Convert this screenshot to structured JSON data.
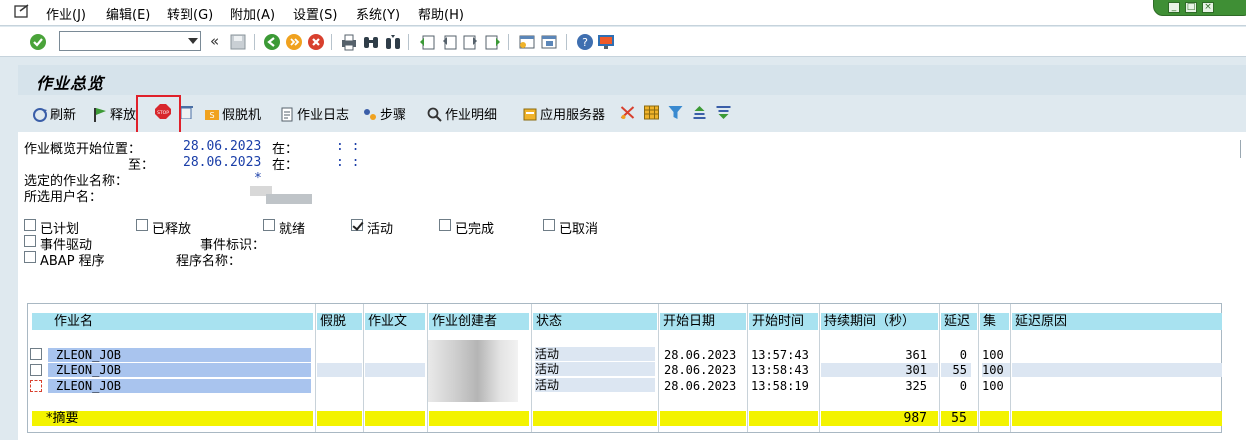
{
  "menu": [
    "作业(J)",
    "编辑(E)",
    "转到(G)",
    "附加(A)",
    "设置(S)",
    "系统(Y)",
    "帮助(H)"
  ],
  "title": "作业总览",
  "app_toolbar": {
    "refresh": "刷新",
    "release": "释放",
    "stop_icon_text": "STOP",
    "spool": "假脱机",
    "job_log": "作业日志",
    "step": "步骤",
    "job_details": "作业明细",
    "app_server": "应用服务器"
  },
  "criteria": {
    "start_label": "作业概览开始位置：",
    "start_date": "28.06.2023",
    "at1": "在：",
    "time1": ": :",
    "to_label": "至：",
    "to_date": "28.06.2023",
    "at2": "在：",
    "time2": ": :",
    "job_name_label": "选定的作业名称：",
    "job_name_value": "*",
    "user_label": "所选用户名："
  },
  "status_filters": [
    {
      "label": "已计划",
      "checked": false
    },
    {
      "label": "已释放",
      "checked": false
    },
    {
      "label": "就绪",
      "checked": false
    },
    {
      "label": "活动",
      "checked": true
    },
    {
      "label": "已完成",
      "checked": false
    },
    {
      "label": "已取消",
      "checked": false
    }
  ],
  "event_driven": "事件驱动",
  "event_id": "事件标识：",
  "abap_program": "ABAP 程序",
  "program_name": "程序名称：",
  "columns": [
    "作业名",
    "假脱",
    "作业文",
    "作业创建者",
    "状态",
    "开始日期",
    "开始时间",
    "持续期间（秒）",
    "延迟",
    "集",
    "延迟原因"
  ],
  "rows": [
    {
      "job": "ZLEON_JOB",
      "status": "活动",
      "date": "28.06.2023",
      "time": "13:57:43",
      "duration": "361",
      "delay": "0",
      "client": "100"
    },
    {
      "job": "ZLEON_JOB",
      "status": "活动",
      "date": "28.06.2023",
      "time": "13:58:43",
      "duration": "301",
      "delay": "55",
      "client": "100"
    },
    {
      "job": "ZLEON_JOB",
      "status": "活动",
      "date": "28.06.2023",
      "time": "13:58:19",
      "duration": "325",
      "delay": "0",
      "client": "100"
    }
  ],
  "summary": {
    "label": "*摘要",
    "duration": "987",
    "delay": "55"
  },
  "colors": {
    "header": "#a8e2f0",
    "summary": "#f3f300",
    "selected": "#a9c4ee",
    "highlight": "#e0202a"
  }
}
